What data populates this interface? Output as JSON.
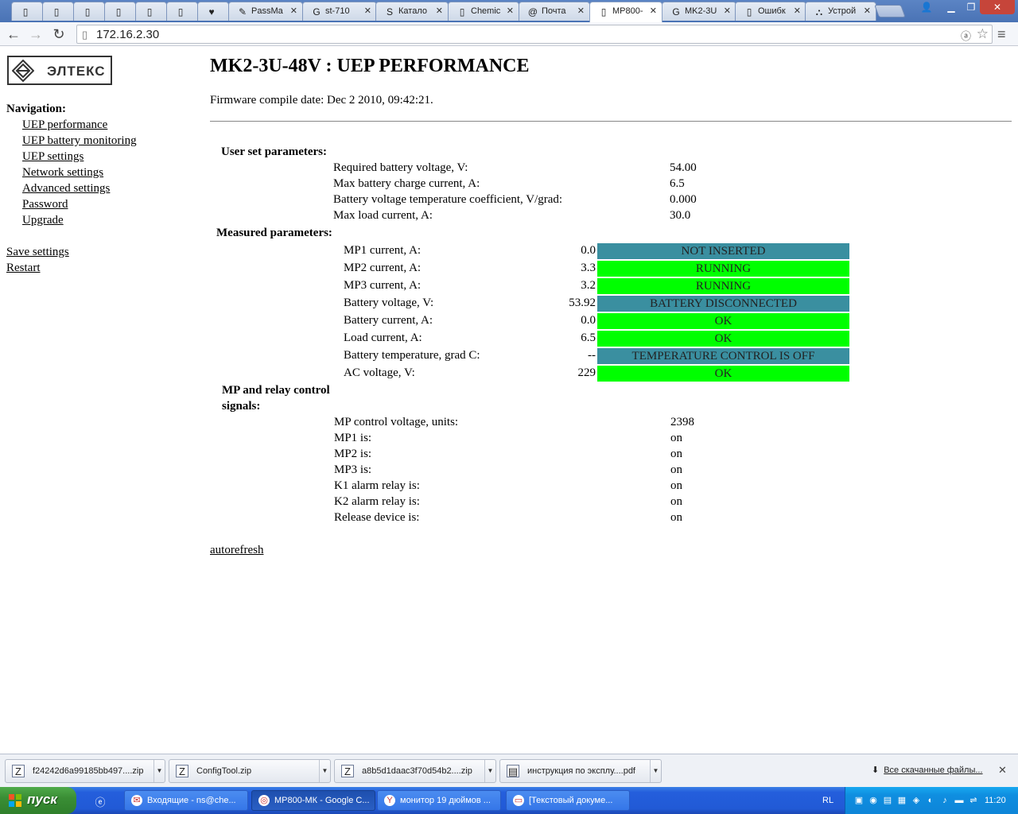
{
  "browser": {
    "tabs": [
      {
        "title": "",
        "icon": "page-icon"
      },
      {
        "title": "",
        "icon": "page-icon"
      },
      {
        "title": "",
        "icon": "page-icon"
      },
      {
        "title": "",
        "icon": "page-icon"
      },
      {
        "title": "",
        "icon": "page-icon"
      },
      {
        "title": "",
        "icon": "page-icon"
      },
      {
        "title": "",
        "icon": "heart-icon"
      },
      {
        "title": "PassMa",
        "icon": "passmark-icon"
      },
      {
        "title": "st-710",
        "icon": "google-icon"
      },
      {
        "title": "Катало",
        "icon": "st-icon"
      },
      {
        "title": "Chemic",
        "icon": "page-icon"
      },
      {
        "title": "Почта",
        "icon": "mail-icon"
      },
      {
        "title": "МР800-",
        "icon": "page-icon"
      },
      {
        "title": "MK2-3U",
        "icon": "google-icon"
      },
      {
        "title": "Ошибк",
        "icon": "page-icon"
      },
      {
        "title": "Устрой",
        "icon": "network-icon"
      }
    ],
    "url": "172.16.2.30"
  },
  "page": {
    "title": "MK2-3U-48V : UEP PERFORMANCE",
    "firmware": "Firmware compile date: Dec 2 2010, 09:42:21.",
    "logo_text": "ЭЛТЕКС",
    "nav_heading": "Navigation:",
    "nav": [
      "UEP performance",
      "UEP battery monitoring",
      "UEP settings",
      "Network settings",
      "Advanced settings",
      "Password",
      "Upgrade"
    ],
    "save_settings": "Save settings",
    "restart": "Restart",
    "user_set": {
      "heading": "User set parameters:",
      "rows": [
        {
          "label": "Required battery voltage, V:",
          "value": "54.00"
        },
        {
          "label": "Max battery charge current, A:",
          "value": "6.5"
        },
        {
          "label": "Battery voltage temperature coefficient, V/grad:",
          "value": "0.000"
        },
        {
          "label": "Max load current, A:",
          "value": "30.0"
        }
      ]
    },
    "measured": {
      "heading": "Measured parameters:",
      "rows": [
        {
          "label": "MP1 current, A:",
          "value": "0.0",
          "status": "NOT INSERTED",
          "color": "#3a8fa0"
        },
        {
          "label": "MP2 current, A:",
          "value": "3.3",
          "status": "RUNNING",
          "color": "#00ff00"
        },
        {
          "label": "MP3 current, A:",
          "value": "3.2",
          "status": "RUNNING",
          "color": "#00ff00"
        },
        {
          "label": "Battery voltage, V:",
          "value": "53.92",
          "status": "BATTERY DISCONNECTED",
          "color": "#3a8fa0"
        },
        {
          "label": "Battery current, A:",
          "value": "0.0",
          "status": "OK",
          "color": "#00ff00"
        },
        {
          "label": "Load current, A:",
          "value": "6.5",
          "status": "OK",
          "color": "#00ff00"
        },
        {
          "label": "Battery temperature, grad C:",
          "value": "--",
          "status": "TEMPERATURE CONTROL IS OFF",
          "color": "#3a8fa0"
        },
        {
          "label": "AC voltage, V:",
          "value": "229",
          "status": "OK",
          "color": "#00ff00"
        }
      ]
    },
    "mp_relay": {
      "heading_line1": "MP and relay control",
      "heading_line2": "signals:",
      "rows": [
        {
          "label": "MP control voltage, units:",
          "value": "2398"
        },
        {
          "label": "MP1 is:",
          "value": "on"
        },
        {
          "label": "MP2 is:",
          "value": "on"
        },
        {
          "label": "MP3 is:",
          "value": "on"
        },
        {
          "label": "K1 alarm relay is:",
          "value": "on"
        },
        {
          "label": "K2 alarm relay is:",
          "value": "on"
        },
        {
          "label": "Release device is:",
          "value": "on"
        }
      ]
    },
    "autorefresh": "autorefresh"
  },
  "downloads": {
    "items": [
      {
        "name": "f24242d6a99185bb497....zip",
        "icon": "zip-icon"
      },
      {
        "name": "ConfigTool.zip",
        "icon": "zip-icon"
      },
      {
        "name": "a8b5d1daac3f70d54b2....zip",
        "icon": "zip-icon"
      },
      {
        "name": "инструкция по эксплу....pdf",
        "icon": "pdf-icon"
      }
    ],
    "show_all": "Все скачанные файлы..."
  },
  "taskbar": {
    "start": "пуск",
    "items": [
      {
        "label": "Входящие - ns@che...",
        "icon": "thunderbird-icon"
      },
      {
        "label": "МР800-МК - Google C...",
        "icon": "chrome-icon"
      },
      {
        "label": "монитор 19 дюймов ...",
        "icon": "yandex-icon"
      },
      {
        "label": "[Текстовый докуме...",
        "icon": "document-icon"
      }
    ],
    "lang": "RL",
    "clock": "11:20"
  }
}
